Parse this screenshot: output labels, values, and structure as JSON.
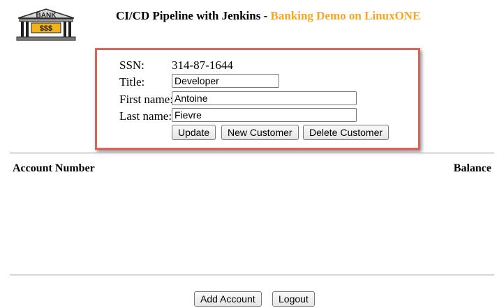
{
  "header": {
    "title_prefix": "CI/CD Pipeline with Jenkins - ",
    "title_accent": "Banking Demo on LinuxONE",
    "logo": {
      "icon": "bank-building-icon",
      "sign": "BANK",
      "symbol": "$$$"
    }
  },
  "customer": {
    "ssn_label": "SSN:",
    "ssn_value": "314-87-1644",
    "title_label": "Title:",
    "title_value": "Developer",
    "first_name_label": "First name:",
    "first_name_value": "Antoine",
    "last_name_label": "Last name:",
    "last_name_value": "Fievre",
    "buttons": {
      "update": "Update",
      "new_customer": "New Customer",
      "delete_customer": "Delete Customer"
    }
  },
  "accounts": {
    "col_account_number": "Account Number",
    "col_balance": "Balance",
    "rows": []
  },
  "footer": {
    "add_account": "Add Account",
    "logout": "Logout"
  },
  "colors": {
    "accent": "#f5a623",
    "box_border": "#d9645a"
  }
}
